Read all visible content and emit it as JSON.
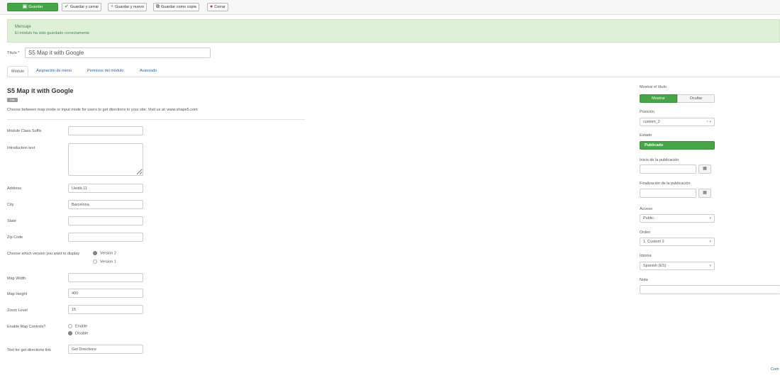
{
  "toolbar": {
    "save": "Guardar",
    "save_close": "Guardar y cerrar",
    "save_new": "Guardar y nuevo",
    "save_copy": "Guardar como copia",
    "close": "Cerrar"
  },
  "message": {
    "heading": "Mensaje",
    "text": "El módulo ha sido guardado correctamente"
  },
  "title_field": {
    "label": "Título *",
    "value": "S5 Map it with Google"
  },
  "tabs": [
    "Módulo",
    "Asignación de menú",
    "Permisos del módulo",
    "Avanzado"
  ],
  "module": {
    "name": "S5 Map it with Google",
    "badge": "Site",
    "description": "Choose between map mode or input mode for users to get directions to your site. Visit us at: www.shape5.com"
  },
  "fields": {
    "class_suffix": {
      "label": "Module Class Suffix",
      "value": ""
    },
    "intro_text": {
      "label": "Introduction text",
      "value": ""
    },
    "address": {
      "label": "Address",
      "value": "Lleidà 11"
    },
    "city": {
      "label": "City",
      "value": "Barcelona"
    },
    "state": {
      "label": "State",
      "value": ""
    },
    "zip": {
      "label": "Zip Code",
      "value": ""
    },
    "version": {
      "label": "Choose which version you want to display",
      "options": [
        "Version 2",
        "Version 1"
      ],
      "selected": "Version 2"
    },
    "map_width": {
      "label": "Map Width",
      "value": ""
    },
    "map_height": {
      "label": "Map Height",
      "value": "400"
    },
    "zoom": {
      "label": "Zoom Level",
      "value": "15"
    },
    "controls": {
      "label": "Enable Map Controls?",
      "options": [
        "Enable",
        "Disable"
      ],
      "selected": "Disable"
    },
    "directions_text": {
      "label": "Text for get directions link",
      "value": "Get Directions"
    }
  },
  "side": {
    "show_title": {
      "label": "Mostrar el título",
      "on": "Mostrar",
      "off": "Ocultar"
    },
    "position": {
      "label": "Posición",
      "value": "custom_2"
    },
    "status": {
      "label": "Estado",
      "value": "Publicado"
    },
    "publish_up": {
      "label": "Inicio de la publicación",
      "value": ""
    },
    "publish_down": {
      "label": "Finalización de la publicación",
      "value": ""
    },
    "access": {
      "label": "Acceso",
      "value": "Public"
    },
    "order": {
      "label": "Orden",
      "value": "1. Custom 2"
    },
    "language": {
      "label": "Idioma",
      "value": "Spanish (ES)"
    },
    "note": {
      "label": "Nota",
      "value": ""
    }
  },
  "footer_link": "Com",
  "colors": {
    "success": "#46a546",
    "danger": "#bd362f",
    "link": "#2a6496",
    "message_bg": "#dff0d8"
  },
  "icons": [
    "save-icon",
    "check-icon",
    "plus-icon",
    "copy-icon",
    "close-icon",
    "calendar-icon",
    "clear-icon",
    "chevron-down-icon"
  ]
}
